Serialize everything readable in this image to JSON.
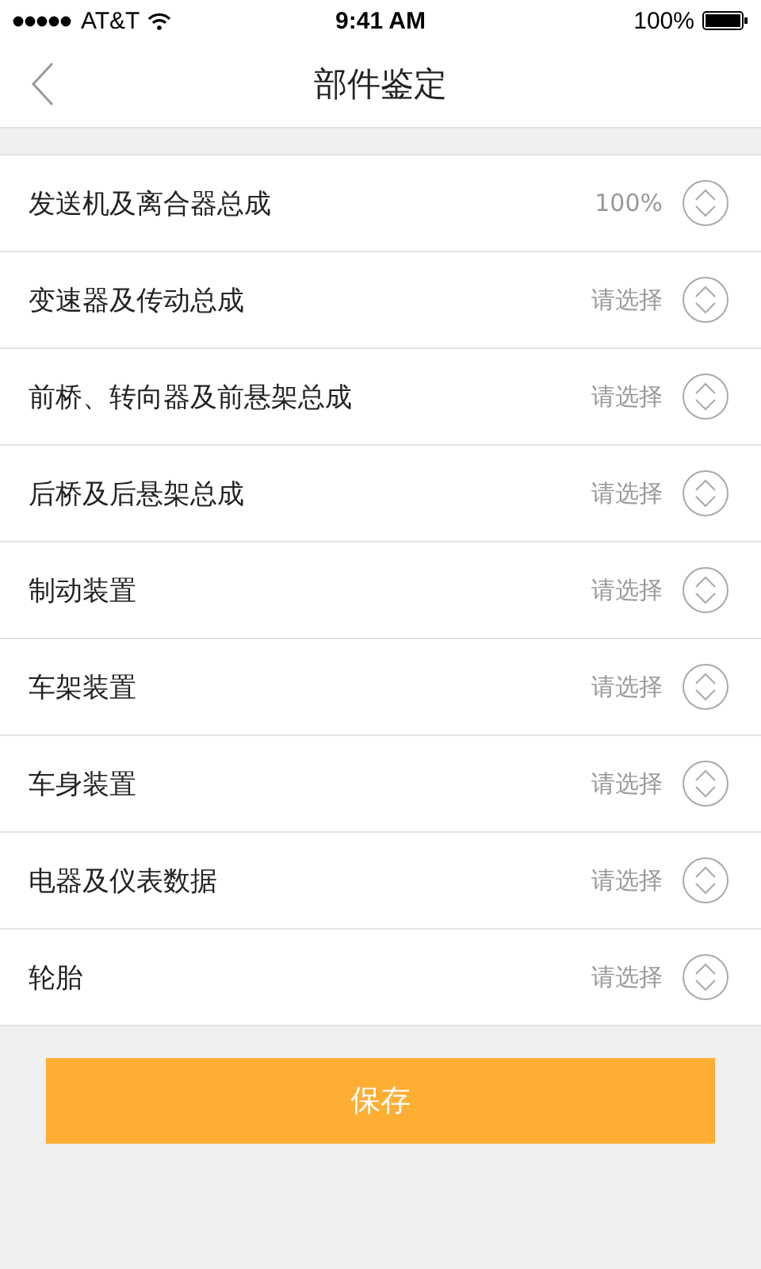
{
  "status_bar": {
    "carrier": "AT&T",
    "time": "9:41 AM",
    "battery": "100%"
  },
  "nav": {
    "title": "部件鉴定"
  },
  "items": [
    {
      "label": "发送机及离合器总成",
      "value": "100%"
    },
    {
      "label": "变速器及传动总成",
      "value": "请选择"
    },
    {
      "label": "前桥、转向器及前悬架总成",
      "value": "请选择"
    },
    {
      "label": "后桥及后悬架总成",
      "value": "请选择"
    },
    {
      "label": "制动装置",
      "value": "请选择"
    },
    {
      "label": "车架装置",
      "value": "请选择"
    },
    {
      "label": "车身装置",
      "value": "请选择"
    },
    {
      "label": "电器及仪表数据",
      "value": "请选择"
    },
    {
      "label": "轮胎",
      "value": "请选择"
    }
  ],
  "save_button": "保存"
}
